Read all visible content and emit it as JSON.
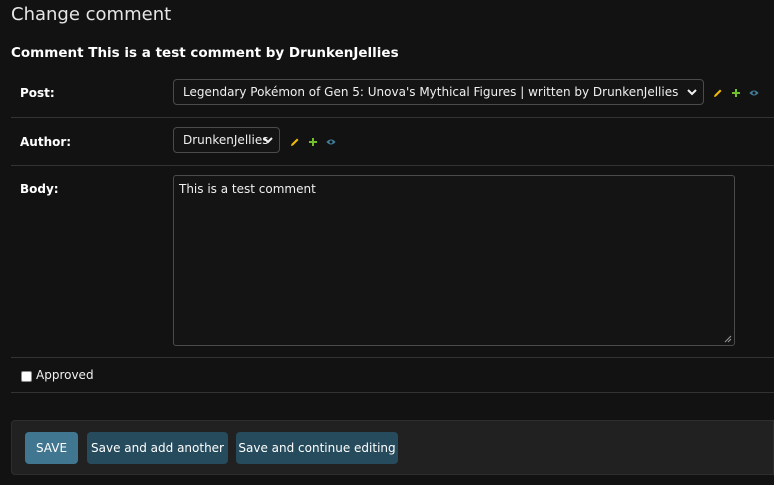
{
  "page": {
    "title": "Change comment",
    "heading": "Comment This is a test comment by DrunkenJellies"
  },
  "fields": {
    "post": {
      "label": "Post:",
      "value": "Legendary Pokémon of Gen 5: Unova's Mythical Figures | written by DrunkenJellies"
    },
    "author": {
      "label": "Author:",
      "value": "DrunkenJellies"
    },
    "body": {
      "label": "Body:",
      "value": "This is a test comment"
    },
    "approved": {
      "label": "Approved",
      "checked": false
    }
  },
  "related_icons": [
    "pencil-icon",
    "plus-icon",
    "eye-icon"
  ],
  "buttons": {
    "save": "SAVE",
    "save_add_another": "Save and add another",
    "save_continue": "Save and continue editing"
  },
  "colors": {
    "background": "#121212",
    "primary_button": "#417690",
    "secondary_button": "#264b5d",
    "pencil": "#efb80b",
    "plus": "#70bf2b",
    "eye": "#447e9b"
  }
}
